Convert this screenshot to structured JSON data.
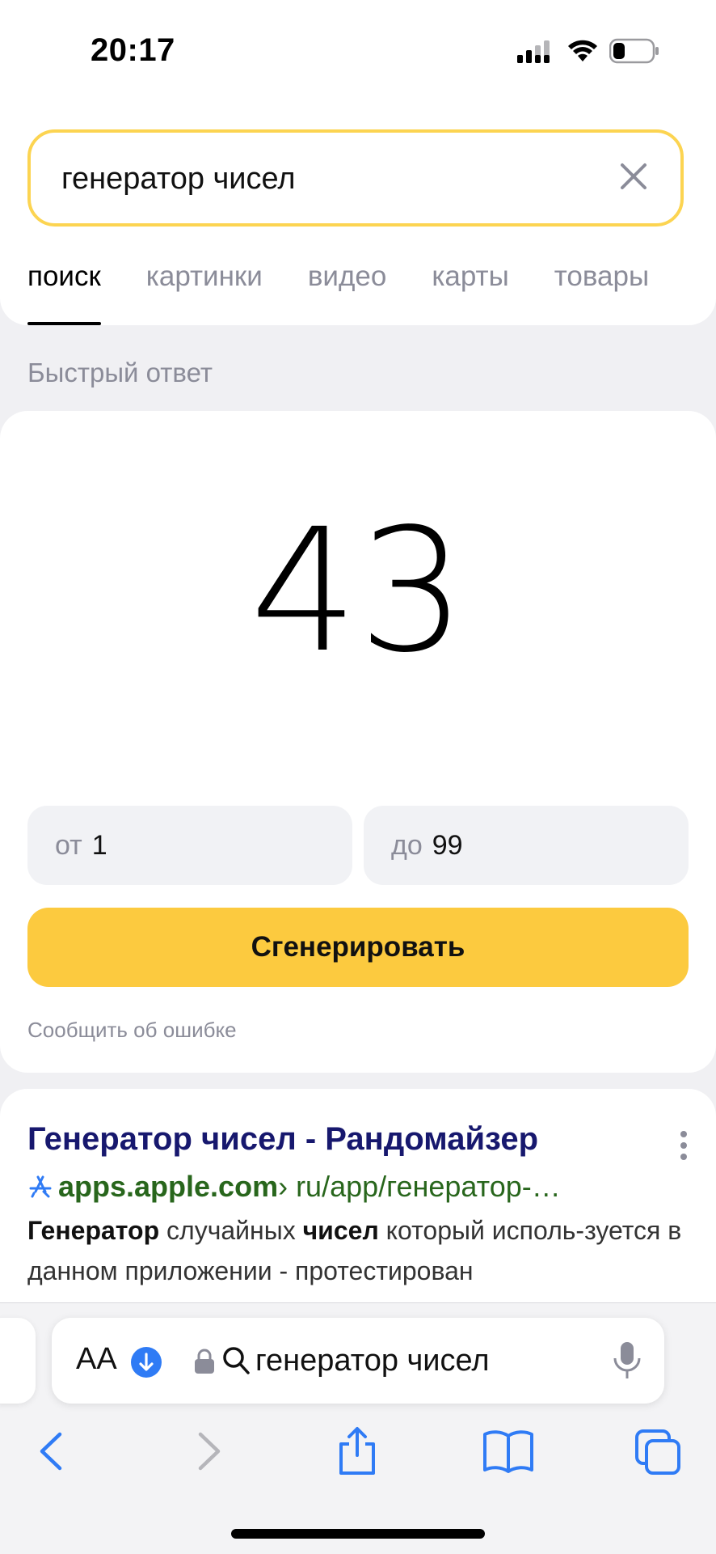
{
  "status_bar": {
    "time": "20:17"
  },
  "search": {
    "query": "генератор чисел"
  },
  "tabs": [
    {
      "label": "поиск",
      "active": true
    },
    {
      "label": "картинки"
    },
    {
      "label": "видео"
    },
    {
      "label": "карты"
    },
    {
      "label": "товары"
    }
  ],
  "quick_answer": {
    "section_title": "Быстрый ответ",
    "result": "43",
    "from_label": "от",
    "from_value": "1",
    "to_label": "до",
    "to_value": "99",
    "generate_button": "Сгенерировать",
    "report_link": "Сообщить об ошибке"
  },
  "result": {
    "title": "Генератор чисел - Рандомайзер",
    "domain": "apps.apple.com",
    "path": " › ru/app/генератор-…",
    "snippet_b1": "Генератор",
    "snippet_t1": " случайных ",
    "snippet_b2": "чисел",
    "snippet_t2": " который исполь-зуется в данном приложении - протестирован"
  },
  "safari": {
    "text_size_label": "AA",
    "address_text": "генератор чисел"
  },
  "colors": {
    "accent_yellow": "#fcca3f",
    "search_border": "#fcd451",
    "link_title": "#17186e",
    "url_green": "#28661c",
    "ios_blue": "#2f7bf5"
  }
}
